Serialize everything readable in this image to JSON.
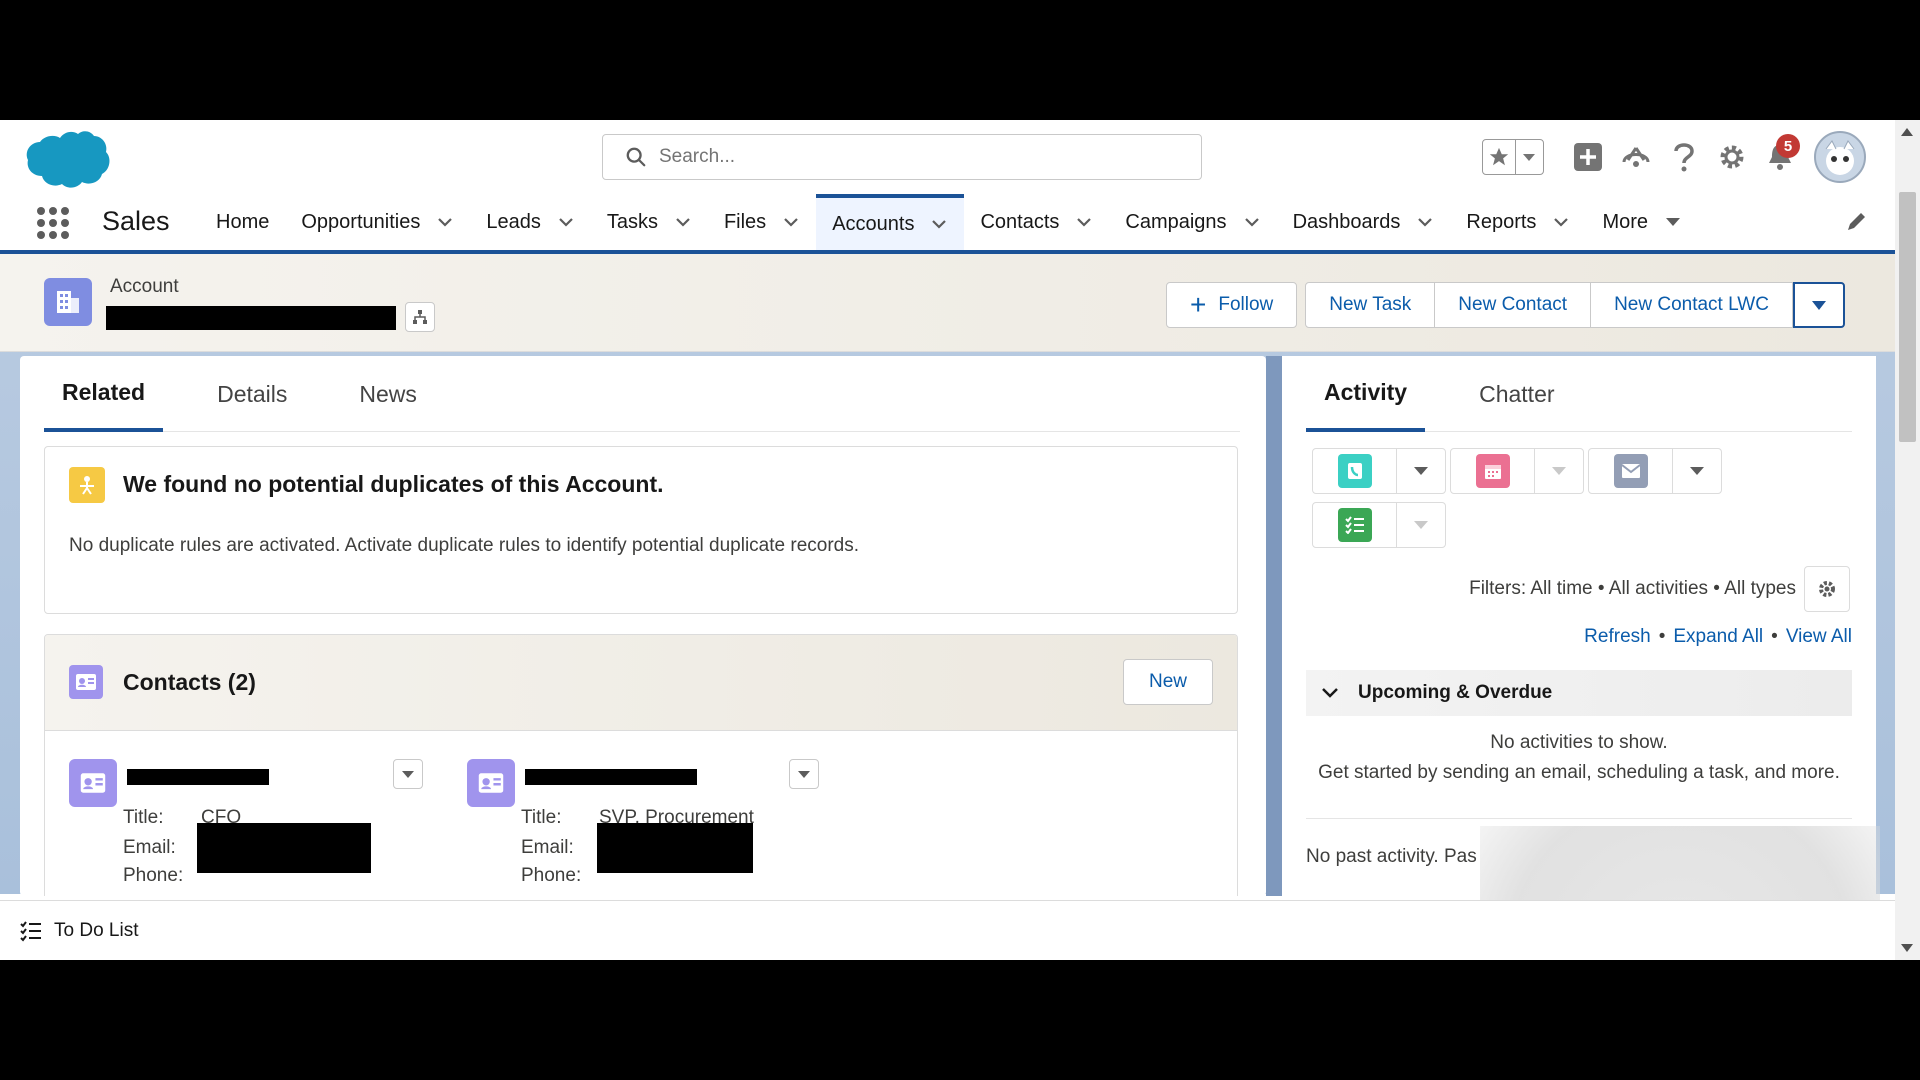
{
  "global_header": {
    "search_placeholder": "Search...",
    "notification_count": "5",
    "icons": [
      "favorites-star-icon",
      "favorites-menu-icon",
      "add-icon",
      "trailhead-icon",
      "help-icon",
      "setup-gear-icon",
      "bell-icon",
      "avatar"
    ]
  },
  "nav": {
    "app_name": "Sales",
    "items": [
      {
        "label": "Home",
        "has_menu": false
      },
      {
        "label": "Opportunities",
        "has_menu": true
      },
      {
        "label": "Leads",
        "has_menu": true
      },
      {
        "label": "Tasks",
        "has_menu": true
      },
      {
        "label": "Files",
        "has_menu": true
      },
      {
        "label": "Accounts",
        "has_menu": true,
        "active": true
      },
      {
        "label": "Contacts",
        "has_menu": true
      },
      {
        "label": "Campaigns",
        "has_menu": true
      },
      {
        "label": "Dashboards",
        "has_menu": true
      },
      {
        "label": "Reports",
        "has_menu": true
      },
      {
        "label": "More",
        "has_menu": true
      }
    ]
  },
  "record": {
    "type_label": "Account",
    "actions": {
      "follow": "Follow",
      "new_task": "New Task",
      "new_contact": "New Contact",
      "new_contact_lwc": "New Contact LWC"
    }
  },
  "left_tabs": {
    "related": "Related",
    "details": "Details",
    "news": "News"
  },
  "duplicates": {
    "title": "We found no potential duplicates of this Account.",
    "text": "No duplicate rules are activated. Activate duplicate rules to identify potential duplicate records."
  },
  "contacts": {
    "title": "Contacts (2)",
    "new_label": "New",
    "labels": {
      "title": "Title:",
      "email": "Email:",
      "phone": "Phone:"
    },
    "items": [
      {
        "title": "CFO"
      },
      {
        "title": "SVP, Procurement"
      }
    ]
  },
  "right_tabs": {
    "activity": "Activity",
    "chatter": "Chatter"
  },
  "activity": {
    "publisher_icons": [
      "log-call-icon",
      "new-event-icon",
      "email-icon",
      "new-task-icon"
    ],
    "filters_text": "Filters: All time • All activities • All types",
    "refresh": "Refresh",
    "expand_all": "Expand All",
    "view_all": "View All",
    "dot": "•",
    "upcoming_title": "Upcoming & Overdue",
    "no_activities": "No activities to show.",
    "get_started": "Get started by sending an email, scheduling a task, and more.",
    "past_activity": "No past activity. Pas"
  },
  "utility_bar": {
    "todo_label": "To Do List"
  },
  "colors": {
    "brand_blue": "#0176d3",
    "nav_active_border": "#1b5297",
    "link": "#0b5cab",
    "account_icon": "#7f8de1",
    "contact_icon": "#a094ed",
    "call_icon": "#3bd0c4",
    "event_icon": "#eb7092",
    "email_icon": "#939eb5",
    "task_icon": "#3ba755",
    "notification_badge": "#c23934"
  }
}
